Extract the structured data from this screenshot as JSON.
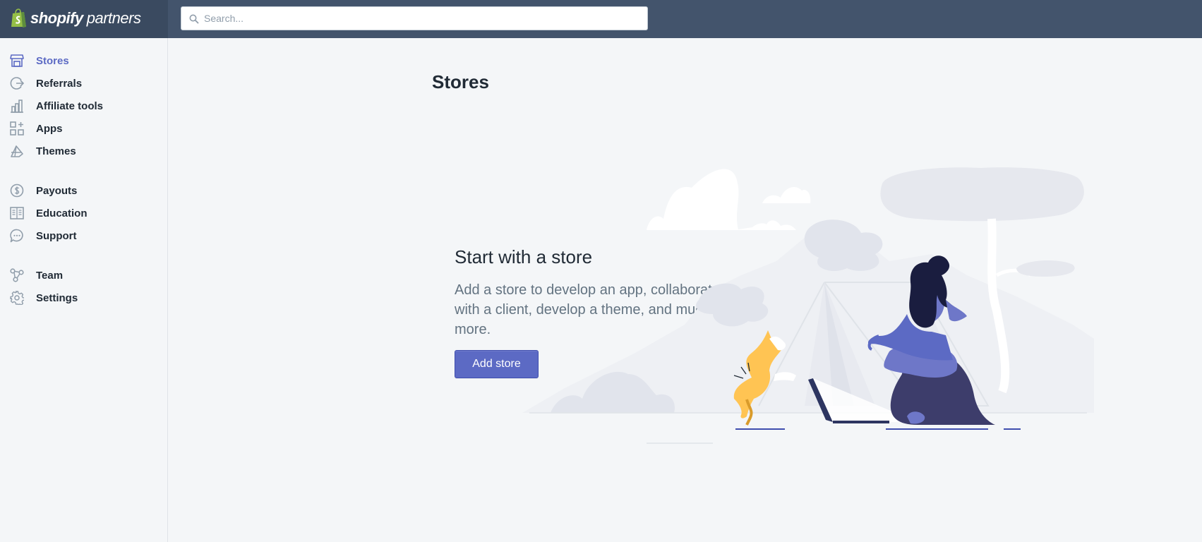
{
  "brand": {
    "bold": "shopify",
    "light": "partners"
  },
  "search": {
    "placeholder": "Search..."
  },
  "sidebar": {
    "items": [
      {
        "label": "Stores",
        "icon": "store-icon",
        "active": true
      },
      {
        "label": "Referrals",
        "icon": "referral-icon"
      },
      {
        "label": "Affiliate tools",
        "icon": "bar-chart-icon"
      },
      {
        "label": "Apps",
        "icon": "apps-grid-icon"
      },
      {
        "label": "Themes",
        "icon": "themes-icon"
      },
      {
        "label": "Payouts",
        "icon": "dollar-circle-icon"
      },
      {
        "label": "Education",
        "icon": "book-icon"
      },
      {
        "label": "Support",
        "icon": "chat-bubble-icon"
      },
      {
        "label": "Team",
        "icon": "team-icon"
      },
      {
        "label": "Settings",
        "icon": "gear-icon"
      }
    ]
  },
  "main": {
    "title": "Stores",
    "empty_state": {
      "heading": "Start with a store",
      "description": "Add a store to develop an app, collaborate with a client, develop a theme, and much more.",
      "button": "Add store"
    }
  },
  "colors": {
    "topbar": "#43546c",
    "accent": "#5c6ac4",
    "background": "#f4f6f8"
  }
}
